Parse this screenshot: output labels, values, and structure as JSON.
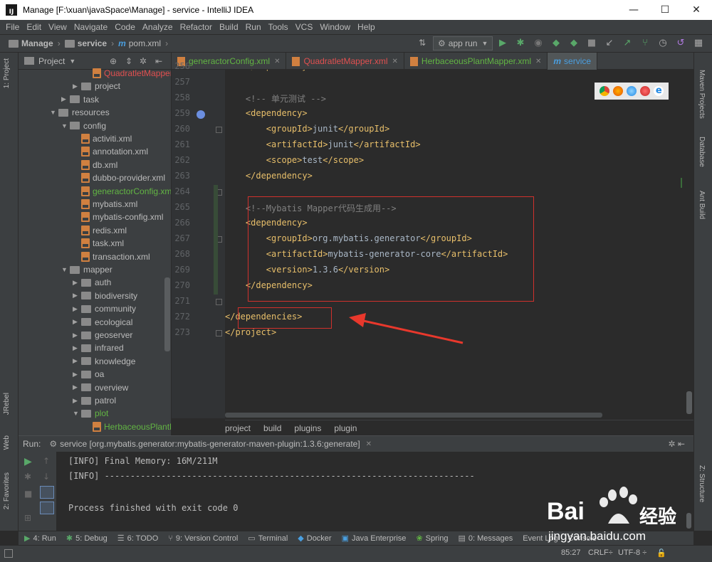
{
  "window": {
    "title": "Manage [F:\\xuan\\javaSpace\\Manage] - service - IntelliJ IDEA",
    "app_icon_text": "IJ",
    "minimize": "—",
    "maximize": "☐",
    "close": "✕"
  },
  "menu": [
    "File",
    "Edit",
    "View",
    "Navigate",
    "Code",
    "Analyze",
    "Refactor",
    "Build",
    "Run",
    "Tools",
    "VCS",
    "Window",
    "Help"
  ],
  "nav": {
    "crumbs": [
      "Manage",
      "service",
      "pom.xml"
    ],
    "run_config": "app run"
  },
  "left_strip": {
    "project": "1: Project",
    "jrebel": "JRebel",
    "web": "Web",
    "favorites": "2: Favorites"
  },
  "right_strip": {
    "maven": "Maven Projects",
    "database": "Database",
    "ant": "Ant Build",
    "structure": "Z: Structure"
  },
  "project_panel": {
    "title": "Project",
    "rows": [
      {
        "label": "QuadratletMapper.xml",
        "kind": "xml",
        "indent": 6,
        "style": "red",
        "arrow": ""
      },
      {
        "label": "project",
        "kind": "folder",
        "indent": 5,
        "style": "",
        "arrow": "▶"
      },
      {
        "label": "task",
        "kind": "folder",
        "indent": 4,
        "style": "",
        "arrow": "▶"
      },
      {
        "label": "resources",
        "kind": "folder",
        "indent": 3,
        "style": "",
        "arrow": "▼"
      },
      {
        "label": "config",
        "kind": "folder",
        "indent": 4,
        "style": "",
        "arrow": "▼"
      },
      {
        "label": "activiti.xml",
        "kind": "xml",
        "indent": 5,
        "style": "",
        "arrow": ""
      },
      {
        "label": "annotation.xml",
        "kind": "xml",
        "indent": 5,
        "style": "",
        "arrow": ""
      },
      {
        "label": "db.xml",
        "kind": "xml",
        "indent": 5,
        "style": "",
        "arrow": ""
      },
      {
        "label": "dubbo-provider.xml",
        "kind": "xml",
        "indent": 5,
        "style": "",
        "arrow": ""
      },
      {
        "label": "generactorConfig.xml",
        "kind": "xml",
        "indent": 5,
        "style": "green",
        "arrow": ""
      },
      {
        "label": "mybatis.xml",
        "kind": "xml",
        "indent": 5,
        "style": "",
        "arrow": ""
      },
      {
        "label": "mybatis-config.xml",
        "kind": "xml",
        "indent": 5,
        "style": "",
        "arrow": ""
      },
      {
        "label": "redis.xml",
        "kind": "xml",
        "indent": 5,
        "style": "",
        "arrow": ""
      },
      {
        "label": "task.xml",
        "kind": "xml",
        "indent": 5,
        "style": "",
        "arrow": ""
      },
      {
        "label": "transaction.xml",
        "kind": "xml",
        "indent": 5,
        "style": "",
        "arrow": ""
      },
      {
        "label": "mapper",
        "kind": "folder",
        "indent": 4,
        "style": "",
        "arrow": "▼"
      },
      {
        "label": "auth",
        "kind": "folder",
        "indent": 5,
        "style": "",
        "arrow": "▶"
      },
      {
        "label": "biodiversity",
        "kind": "folder",
        "indent": 5,
        "style": "",
        "arrow": "▶"
      },
      {
        "label": "community",
        "kind": "folder",
        "indent": 5,
        "style": "",
        "arrow": "▶"
      },
      {
        "label": "ecological",
        "kind": "folder",
        "indent": 5,
        "style": "",
        "arrow": "▶"
      },
      {
        "label": "geoserver",
        "kind": "folder",
        "indent": 5,
        "style": "",
        "arrow": "▶"
      },
      {
        "label": "infrared",
        "kind": "folder",
        "indent": 5,
        "style": "",
        "arrow": "▶"
      },
      {
        "label": "knowledge",
        "kind": "folder",
        "indent": 5,
        "style": "",
        "arrow": "▶"
      },
      {
        "label": "oa",
        "kind": "folder",
        "indent": 5,
        "style": "",
        "arrow": "▶"
      },
      {
        "label": "overview",
        "kind": "folder",
        "indent": 5,
        "style": "",
        "arrow": "▶"
      },
      {
        "label": "patrol",
        "kind": "folder",
        "indent": 5,
        "style": "",
        "arrow": "▶"
      },
      {
        "label": "plot",
        "kind": "folder",
        "indent": 5,
        "style": "green",
        "arrow": "▼"
      },
      {
        "label": "HerbaceousPlantMapper.xml",
        "kind": "xml",
        "indent": 6,
        "style": "green",
        "arrow": ""
      }
    ]
  },
  "editor_tabs": [
    {
      "label": "generactorConfig.xml",
      "color": "green",
      "active": false
    },
    {
      "label": "QuadratletMapper.xml",
      "color": "red",
      "active": false
    },
    {
      "label": "HerbaceousPlantMapper.xml",
      "color": "green",
      "active": false
    },
    {
      "label": "service",
      "color": "blue",
      "active": true
    }
  ],
  "code_lines": [
    {
      "num": "256",
      "indent": "    ",
      "parts": [
        [
          "tag",
          "</dependency>"
        ]
      ]
    },
    {
      "num": "257",
      "indent": "",
      "parts": []
    },
    {
      "num": "258",
      "indent": "    ",
      "parts": [
        [
          "cmt",
          "<!-- 单元测试 -->"
        ]
      ]
    },
    {
      "num": "259",
      "indent": "    ",
      "parts": [
        [
          "tag",
          "<dependency>"
        ]
      ]
    },
    {
      "num": "260",
      "indent": "        ",
      "parts": [
        [
          "tag",
          "<groupId>"
        ],
        [
          "txt",
          "junit"
        ],
        [
          "tag",
          "</groupId>"
        ]
      ]
    },
    {
      "num": "261",
      "indent": "        ",
      "parts": [
        [
          "tag",
          "<artifactId>"
        ],
        [
          "txt",
          "junit"
        ],
        [
          "tag",
          "</artifactId>"
        ]
      ]
    },
    {
      "num": "262",
      "indent": "        ",
      "parts": [
        [
          "tag",
          "<scope>"
        ],
        [
          "txt",
          "test"
        ],
        [
          "tag",
          "</scope>"
        ]
      ]
    },
    {
      "num": "263",
      "indent": "    ",
      "parts": [
        [
          "tag",
          "</dependency>"
        ]
      ]
    },
    {
      "num": "264",
      "indent": "",
      "parts": []
    },
    {
      "num": "265",
      "indent": "    ",
      "parts": [
        [
          "cmt",
          "<!--Mybatis Mapper代码生成用-->"
        ]
      ]
    },
    {
      "num": "266",
      "indent": "    ",
      "parts": [
        [
          "tag",
          "<dependency>"
        ]
      ]
    },
    {
      "num": "267",
      "indent": "        ",
      "parts": [
        [
          "tag",
          "<groupId>"
        ],
        [
          "txt",
          "org.mybatis.generator"
        ],
        [
          "tag",
          "</groupId>"
        ]
      ]
    },
    {
      "num": "268",
      "indent": "        ",
      "parts": [
        [
          "tag",
          "<artifactId>"
        ],
        [
          "txt",
          "mybatis-generator-core"
        ],
        [
          "tag",
          "</artifactId>"
        ]
      ]
    },
    {
      "num": "269",
      "indent": "        ",
      "parts": [
        [
          "tag",
          "<version>"
        ],
        [
          "txt",
          "1.3.6"
        ],
        [
          "tag",
          "</version>"
        ]
      ]
    },
    {
      "num": "270",
      "indent": "    ",
      "parts": [
        [
          "tag",
          "</dependency>"
        ]
      ]
    },
    {
      "num": "271",
      "indent": "",
      "parts": []
    },
    {
      "num": "272",
      "indent": "",
      "parts": [
        [
          "tag",
          "</dependencies>"
        ]
      ]
    },
    {
      "num": "273",
      "indent": "",
      "parts": [
        [
          "tag",
          "</project>"
        ]
      ]
    }
  ],
  "breadcrumbs": [
    "project",
    "build",
    "plugins",
    "plugin"
  ],
  "run": {
    "label": "Run:",
    "tab": "service [org.mybatis.generator:mybatis-generator-maven-plugin:1.3.6:generate]",
    "close": "✕",
    "console": [
      "[INFO] Final Memory: 16M/211M",
      "[INFO] ------------------------------------------------------------------------",
      "",
      "Process finished with exit code 0"
    ]
  },
  "bottom_tabs": [
    "4: Run",
    "5: Debug",
    "6: TODO",
    "9: Version Control",
    "Terminal",
    "Docker",
    "Java Enterprise",
    "Spring",
    "0: Messages",
    "Event Log",
    "Console"
  ],
  "status": {
    "position": "85:27",
    "line_sep": "CRLF÷",
    "encoding": "UTF-8 ÷"
  },
  "watermark": {
    "brand": "Bai",
    "brand2": "经验",
    "url": "jingyan.baidu.com"
  }
}
